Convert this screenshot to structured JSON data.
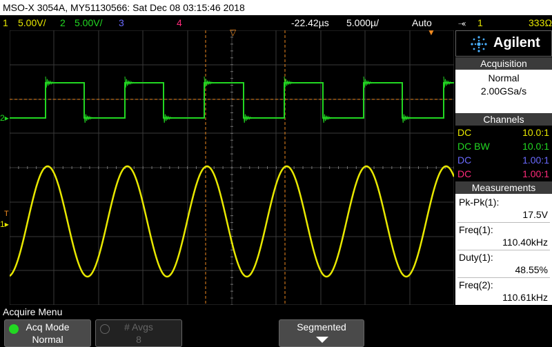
{
  "title_bar": {
    "text": "MSO-X 3054A, MY51130566: Sat Dec 08 03:15:46 2018"
  },
  "status": {
    "ch1_num": "1",
    "ch1_scale": "5.00V/",
    "ch2_num": "2",
    "ch2_scale": "5.00V/",
    "ch3_num": "3",
    "ch4_num": "4",
    "delay": "-22.42µs",
    "timebase": "5.000µ/",
    "trigger_mode": "Auto",
    "trig_ch": "1",
    "trig_level": "333Ω"
  },
  "colors": {
    "ch1": "#e8e800",
    "ch2": "#22d822",
    "ch3": "#6a6aff",
    "ch4": "#ff2a7a",
    "cursor": "#f08a20"
  },
  "brand": {
    "name": "Agilent"
  },
  "acquisition": {
    "header": "Acquisition",
    "mode": "Normal",
    "rate": "2.00GSa/s"
  },
  "channels": {
    "header": "Channels",
    "rows": [
      {
        "coupling": "DC",
        "probe": "10.0:1"
      },
      {
        "coupling": "DC BW",
        "probe": "10.0:1"
      },
      {
        "coupling": "DC",
        "probe": "1.00:1"
      },
      {
        "coupling": "DC",
        "probe": "1.00:1"
      }
    ]
  },
  "measurements": {
    "header": "Measurements",
    "items": [
      {
        "label": "Pk-Pk(1):",
        "value": "17.5V"
      },
      {
        "label": "Freq(1):",
        "value": "110.40kHz"
      },
      {
        "label": "Duty(1):",
        "value": "48.55%"
      },
      {
        "label": "Freq(2):",
        "value": "110.61kHz"
      }
    ]
  },
  "markers": {
    "ch2": "2",
    "ch1": "1",
    "trig": "T"
  },
  "menu": {
    "title": "Acquire Menu",
    "acq_mode_label": "Acq Mode",
    "acq_mode_value": "Normal",
    "avgs_label": "# Avgs",
    "avgs_value": "8",
    "segmented_label": "Segmented"
  }
}
